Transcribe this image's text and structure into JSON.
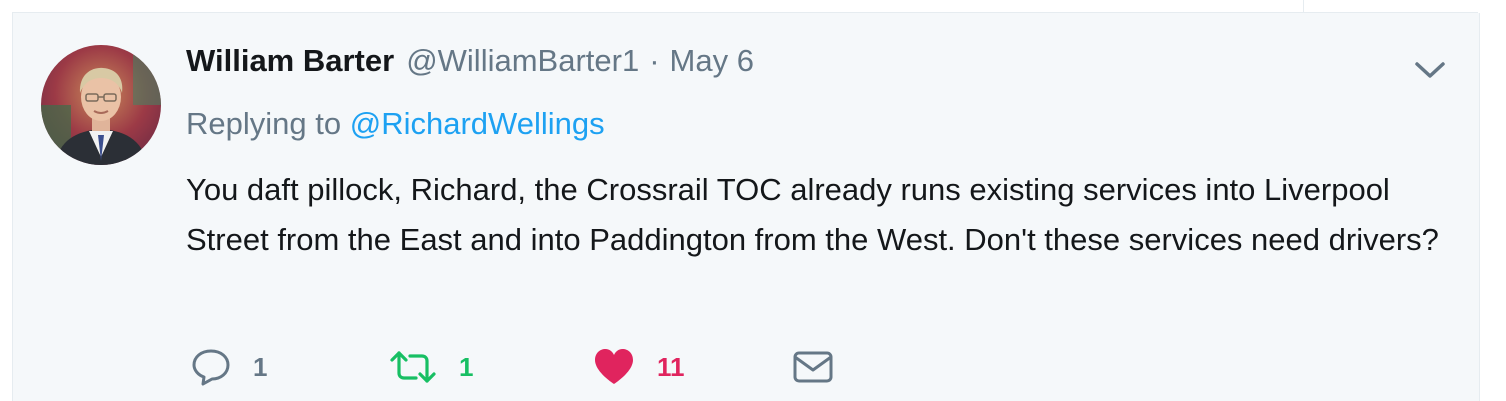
{
  "tweet": {
    "author": {
      "fullname": "William Barter",
      "username": "@WilliamBarter1",
      "avatar_icon": "profile-photo"
    },
    "separator": "·",
    "timestamp": "May 6",
    "reply_context": {
      "prefix": "Replying to",
      "mention": "@RichardWellings"
    },
    "text": "You daft pillock, Richard, the Crossrail TOC already runs existing services into Liverpool Street from the East and into Paddington from the West. Don't these services need drivers?",
    "actions": {
      "reply": {
        "icon": "reply-icon",
        "count": "1"
      },
      "retweet": {
        "icon": "retweet-icon",
        "count": "1",
        "active": true
      },
      "like": {
        "icon": "heart-icon",
        "count": "11",
        "active": true
      },
      "dm": {
        "icon": "envelope-icon"
      }
    },
    "more_menu_icon": "chevron-down-icon"
  },
  "colors": {
    "background": "#f5f8fa",
    "text": "#14171a",
    "secondary": "#657786",
    "link": "#1da1f2",
    "retweet": "#17bf63",
    "like": "#e0245e"
  }
}
